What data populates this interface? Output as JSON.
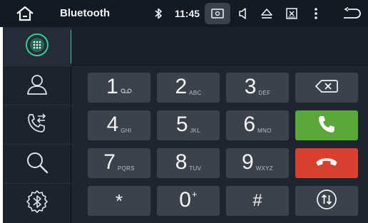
{
  "statusbar": {
    "title": "Bluetooth",
    "time": "11:45",
    "icons": [
      "home-icon",
      "bluetooth-icon",
      "screenshot-icon",
      "volume-icon",
      "eject-icon",
      "close-window-icon",
      "more-vertical-icon",
      "back-icon"
    ]
  },
  "sidebar": {
    "items": [
      {
        "name": "dialpad",
        "icon": "dialpad-icon",
        "active": true
      },
      {
        "name": "contacts",
        "icon": "person-icon",
        "active": false
      },
      {
        "name": "call-log",
        "icon": "call-transfer-icon",
        "active": false
      },
      {
        "name": "search",
        "icon": "search-icon",
        "active": false
      },
      {
        "name": "bluetooth-settings",
        "icon": "bluetooth-gear-icon",
        "active": false
      }
    ]
  },
  "display": {
    "number": ""
  },
  "keypad": {
    "keys": [
      {
        "digit": "1",
        "letters": "",
        "voicemail": true
      },
      {
        "digit": "2",
        "letters": "ABC"
      },
      {
        "digit": "3",
        "letters": "DEF"
      },
      {
        "digit": "4",
        "letters": "GHI"
      },
      {
        "digit": "5",
        "letters": "JKL"
      },
      {
        "digit": "6",
        "letters": "MNO"
      },
      {
        "digit": "7",
        "letters": "PQRS"
      },
      {
        "digit": "8",
        "letters": "TUV"
      },
      {
        "digit": "9",
        "letters": "WXYZ"
      },
      {
        "digit": "*",
        "letters": ""
      },
      {
        "digit": "0",
        "letters": "+"
      },
      {
        "digit": "#",
        "letters": ""
      }
    ],
    "function_keys": [
      "backspace-icon",
      "call-icon",
      "hang-up-icon",
      "swap-audio-icon"
    ]
  },
  "colors": {
    "accent": "#2fd091",
    "call": "#5aa83a",
    "hangup": "#d8402f",
    "key": "#3b424c",
    "background": "#1f252e"
  }
}
